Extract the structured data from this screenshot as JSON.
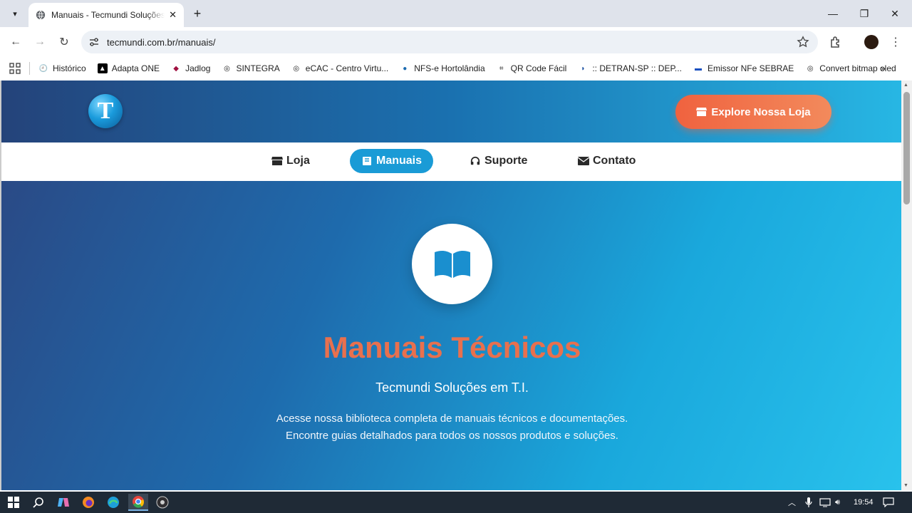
{
  "browser": {
    "tab_title": "Manuais - Tecmundi Soluções em T.I.",
    "url": "tecmundi.com.br/manuais/",
    "bookmarks": [
      {
        "label": "Histórico",
        "icon": "history-icon"
      },
      {
        "label": "Adapta ONE",
        "icon": "adapta-icon"
      },
      {
        "label": "Jadlog",
        "icon": "jadlog-icon"
      },
      {
        "label": "SINTEGRA",
        "icon": "globe-icon"
      },
      {
        "label": "eCAC - Centro Virtu...",
        "icon": "globe-icon"
      },
      {
        "label": "NFS-e Hortolândia",
        "icon": "nfse-icon"
      },
      {
        "label": "QR Code Fácil",
        "icon": "qrcode-icon"
      },
      {
        "label": ":: DETRAN-SP :: DEP...",
        "icon": "detran-icon"
      },
      {
        "label": "Emissor NFe SEBRAE",
        "icon": "sebrae-icon"
      },
      {
        "label": "Convert bitmap oled",
        "icon": "globe-icon"
      }
    ]
  },
  "site": {
    "cta_label": "Explore Nossa Loja",
    "nav": [
      {
        "label": "Loja",
        "icon": "store-icon"
      },
      {
        "label": "Manuais",
        "icon": "book-icon",
        "active": true
      },
      {
        "label": "Suporte",
        "icon": "headset-icon"
      },
      {
        "label": "Contato",
        "icon": "envelope-icon"
      }
    ],
    "hero": {
      "title": "Manuais Técnicos",
      "subtitle": "Tecmundi Soluções em T.I.",
      "desc_line1": "Acesse nossa biblioteca completa de manuais técnicos e documentações.",
      "desc_line2": "Encontre guias detalhados para todos os nossos produtos e soluções."
    }
  },
  "taskbar": {
    "time": "19:54"
  },
  "colors": {
    "accent": "#1a9bd6",
    "cta": "#f0623f",
    "title": "#e8704e"
  }
}
